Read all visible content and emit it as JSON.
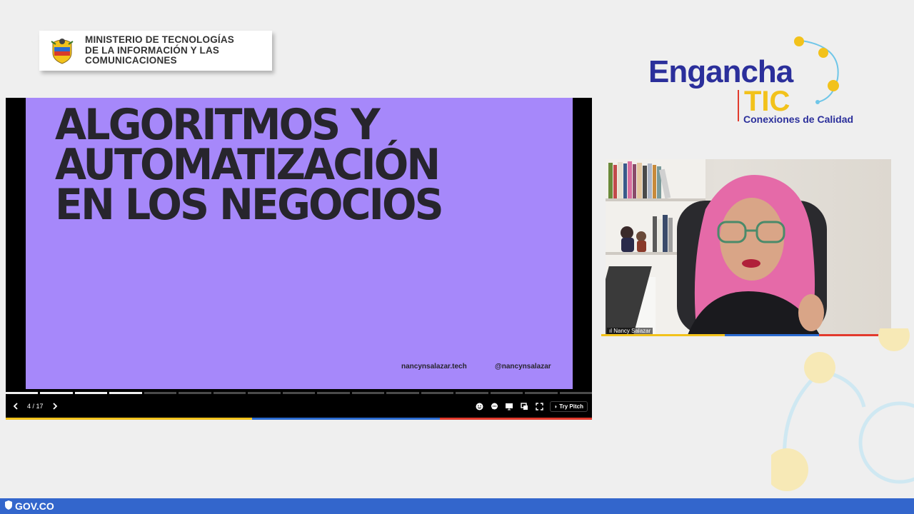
{
  "ministry": {
    "lines": [
      "MINISTERIO DE TECNOLOGÍAS",
      "DE LA INFORMACIÓN Y LAS",
      "COMUNICACIONES"
    ]
  },
  "logo": {
    "word": "Engancha",
    "tic": "TIC",
    "tagline": "Conexiones de Calidad"
  },
  "slide": {
    "title_lines": [
      "ALGORITMOS Y",
      "AUTOMATIZACIÓN",
      "EN LOS NEGOCIOS"
    ],
    "website": "nancynsalazar.tech",
    "handle": "@nancynsalazar",
    "bg_color": "#a688fa"
  },
  "player": {
    "page_counter": "4 / 17",
    "current_slide": 4,
    "total_slides": 17,
    "try_label": "Try Pitch",
    "icons": [
      "emoji-icon",
      "comment-icon",
      "present-icon",
      "window-icon",
      "fullscreen-icon"
    ]
  },
  "webcam": {
    "participant_name": "Nancy Salazar"
  },
  "footer": {
    "gov_label": "GOV.CO"
  },
  "colors": {
    "brand_blue": "#2b2f9b",
    "brand_yellow": "#f2c21b",
    "brand_red": "#e23a2d",
    "gov_blue": "#3366cc"
  }
}
